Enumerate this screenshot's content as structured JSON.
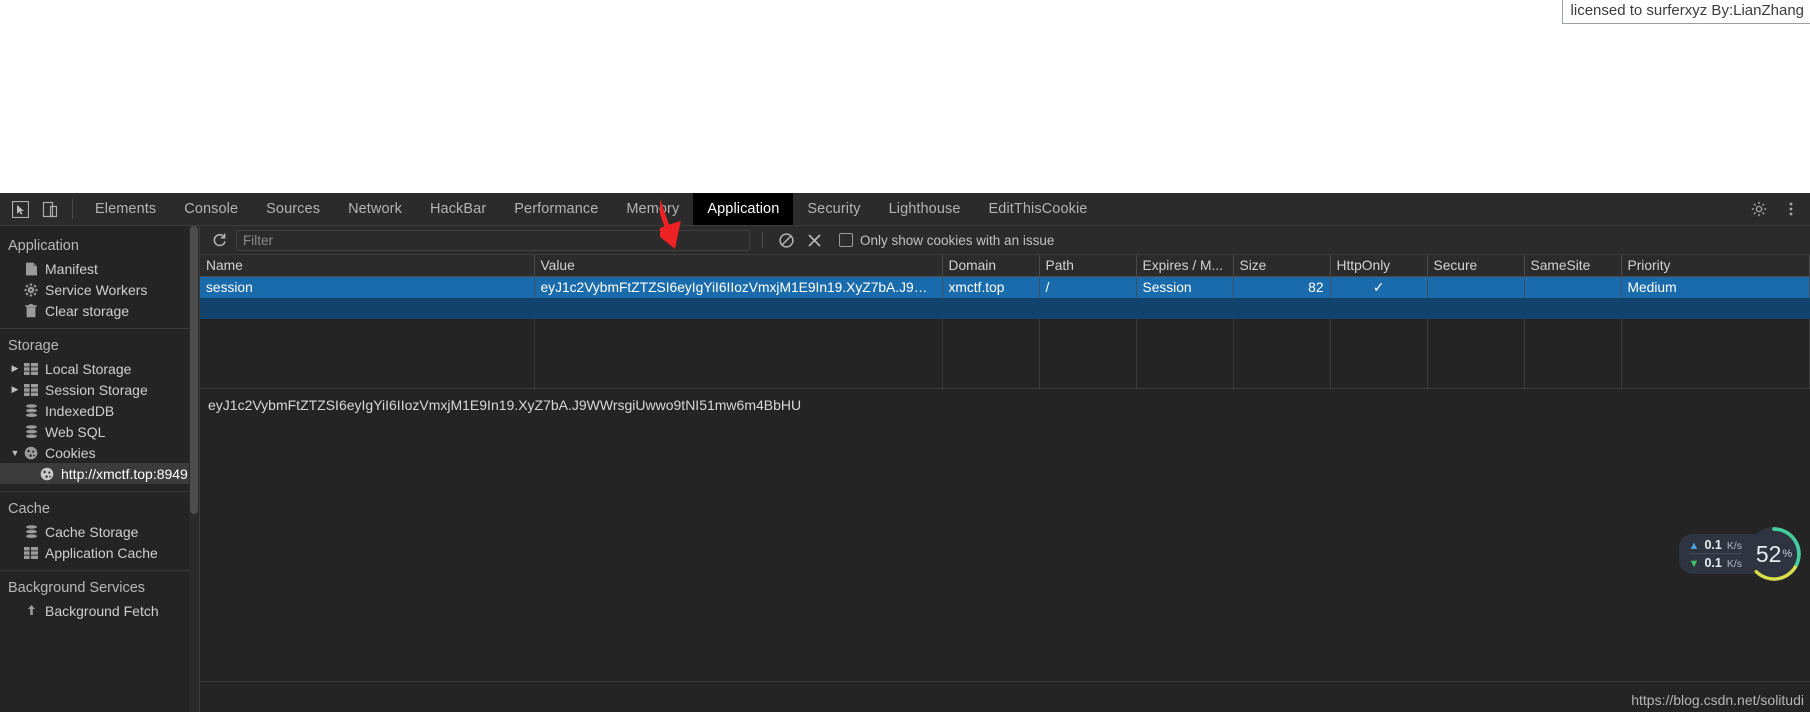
{
  "overlay": {
    "license_text": "licensed to surferxyz By:LianZhang",
    "watermark": "https://blog.csdn.net/solitudi"
  },
  "devtools": {
    "left_tools": [
      {
        "name": "inspect-element-icon",
        "label": ""
      },
      {
        "name": "device-toolbar-icon",
        "label": ""
      }
    ],
    "tabs": [
      {
        "label": "Elements",
        "selected": false
      },
      {
        "label": "Console",
        "selected": false
      },
      {
        "label": "Sources",
        "selected": false
      },
      {
        "label": "Network",
        "selected": false
      },
      {
        "label": "HackBar",
        "selected": false
      },
      {
        "label": "Performance",
        "selected": false
      },
      {
        "label": "Memory",
        "selected": false
      },
      {
        "label": "Application",
        "selected": true
      },
      {
        "label": "Security",
        "selected": false
      },
      {
        "label": "Lighthouse",
        "selected": false
      },
      {
        "label": "EditThisCookie",
        "selected": false
      }
    ],
    "right_icons": [
      {
        "name": "settings-gear-icon"
      },
      {
        "name": "more-options-icon"
      }
    ]
  },
  "sidebar": {
    "sections": [
      {
        "title": "Application",
        "items": [
          {
            "label": "Manifest",
            "icon": "manifest-document-icon",
            "arrow": "",
            "selected": false,
            "child": false
          },
          {
            "label": "Service Workers",
            "icon": "service-workers-gear-icon",
            "arrow": "",
            "selected": false,
            "child": false
          },
          {
            "label": "Clear storage",
            "icon": "clear-storage-trash-icon",
            "arrow": "",
            "selected": false,
            "child": false
          }
        ]
      },
      {
        "title": "Storage",
        "items": [
          {
            "label": "Local Storage",
            "icon": "table-grid-icon",
            "arrow": "▶",
            "selected": false,
            "child": false
          },
          {
            "label": "Session Storage",
            "icon": "table-grid-icon",
            "arrow": "▶",
            "selected": false,
            "child": false
          },
          {
            "label": "IndexedDB",
            "icon": "database-icon",
            "arrow": "",
            "selected": false,
            "child": false
          },
          {
            "label": "Web SQL",
            "icon": "database-icon",
            "arrow": "",
            "selected": false,
            "child": false
          },
          {
            "label": "Cookies",
            "icon": "cookie-icon",
            "arrow": "▼",
            "selected": false,
            "child": false
          },
          {
            "label": "http://xmctf.top:8949",
            "icon": "cookie-icon",
            "arrow": "",
            "selected": true,
            "child": true
          }
        ]
      },
      {
        "title": "Cache",
        "items": [
          {
            "label": "Cache Storage",
            "icon": "database-icon",
            "arrow": "",
            "selected": false,
            "child": false
          },
          {
            "label": "Application Cache",
            "icon": "table-grid-icon",
            "arrow": "",
            "selected": false,
            "child": false
          }
        ]
      },
      {
        "title": "Background Services",
        "items": [
          {
            "label": "Background Fetch",
            "icon": "background-fetch-icon",
            "arrow": "",
            "selected": false,
            "child": false
          }
        ]
      }
    ]
  },
  "cookie_toolbar": {
    "refresh_icon": "refresh-icon",
    "filter_placeholder": "Filter",
    "filter_value": "",
    "clear_all_icon": "clear-all-cookies-icon",
    "delete_icon": "delete-selected-cookie-icon",
    "issue_checkbox_label": "Only show cookies with an issue",
    "issue_checkbox_checked": false
  },
  "cookie_table": {
    "columns": [
      "Name",
      "Value",
      "Domain",
      "Path",
      "Expires / M...",
      "Size",
      "HttpOnly",
      "Secure",
      "SameSite",
      "Priority"
    ],
    "rows": [
      {
        "name": "session",
        "value": "eyJ1c2VybmFtZTZSI6eyIgYiI6IIozVmxjM1E9In19.XyZ7bA.J9WWrsgiUw…",
        "domain": "xmctf.top",
        "path": "/",
        "expires": "Session",
        "size": "82",
        "httponly": "✓",
        "secure": "",
        "samesite": "",
        "priority": "Medium",
        "selected": true
      }
    ],
    "empty_rows": 4
  },
  "value_preview": {
    "text": "eyJ1c2VybmFtZTZSI6eyIgYiI6IIozVmxjM1E9In19.XyZ7bA.J9WWrsgiUwwo9tNI51mw6m4BbHU"
  },
  "speed_widget": {
    "upload_rate": "0.1",
    "upload_unit": "K/s",
    "download_rate": "0.1",
    "download_unit": "K/s",
    "percent": "52",
    "percent_symbol": "%"
  },
  "colors": {
    "devtools_bg": "#242424",
    "toolbar_bg": "#2b2b2b",
    "selection_blue": "#1a6bab",
    "selected_tab_bg": "#000000",
    "arrow_red": "#ee2222"
  }
}
